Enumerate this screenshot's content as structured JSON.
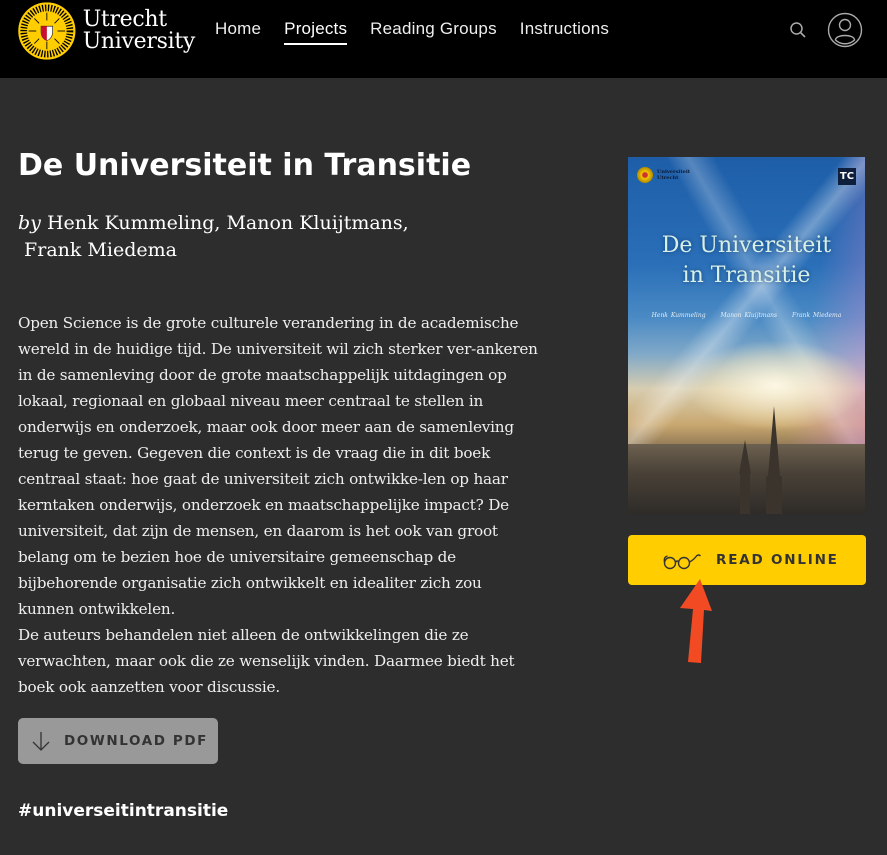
{
  "header": {
    "logo": {
      "line1": "Utrecht",
      "line2": "University"
    },
    "nav": [
      {
        "label": "Home",
        "active": false
      },
      {
        "label": "Projects",
        "active": true
      },
      {
        "label": "Reading Groups",
        "active": false
      },
      {
        "label": "Instructions",
        "active": false
      }
    ],
    "icons": {
      "search": "search-icon",
      "user": "user-account-icon"
    }
  },
  "book": {
    "title": "De Universiteit in Transitie",
    "by_label": "by",
    "authors_line1": "Henk Kummeling, Manon Kluijtmans,",
    "authors_line2": "Frank Miedema",
    "description": [
      "Open Science is de grote culturele verandering in de academische wereld in de huidige tijd. De universiteit wil zich sterker ver-ankeren in de samenleving door de grote maatschappelijk uitdagingen op lokaal, regionaal en globaal niveau meer centraal te stellen in onderwijs en onderzoek, maar ook door meer aan de samenleving terug te geven. Gegeven die context is de vraag die in dit boek centraal staat: hoe gaat de universiteit zich ontwikke-len op haar kerntaken onderwijs, onderzoek en maatschappelijke impact? De universiteit, dat zijn de mensen, en daarom is het ook van groot belang om te bezien hoe de universitaire gemeenschap de bijbehorende organisatie zich ontwikkelt en idealiter zich zou kunnen ontwikkelen.",
      "De auteurs behandelen niet alleen de ontwikkelingen die ze verwachten, maar ook die ze wenselijk vinden. Daarmee biedt het boek ook aanzetten voor discussie."
    ],
    "download_label": "DOWNLOAD PDF",
    "hashtag": "#universeitintransitie",
    "read_online_label": "READ ONLINE"
  },
  "cover": {
    "publisher_line1": "Universiteit",
    "publisher_line2": "Utrecht",
    "badge": "TC",
    "title_line1": "De Universiteit",
    "title_line2": "in Transitie",
    "authors": [
      "Henk Kummeling",
      "Manon Kluijtmans",
      "Frank Miedema"
    ]
  },
  "colors": {
    "header_bg": "#000000",
    "page_bg": "#2d2d2d",
    "read_button": "#ffcd00",
    "download_button": "#999999",
    "annotation_arrow": "#f24b24"
  }
}
